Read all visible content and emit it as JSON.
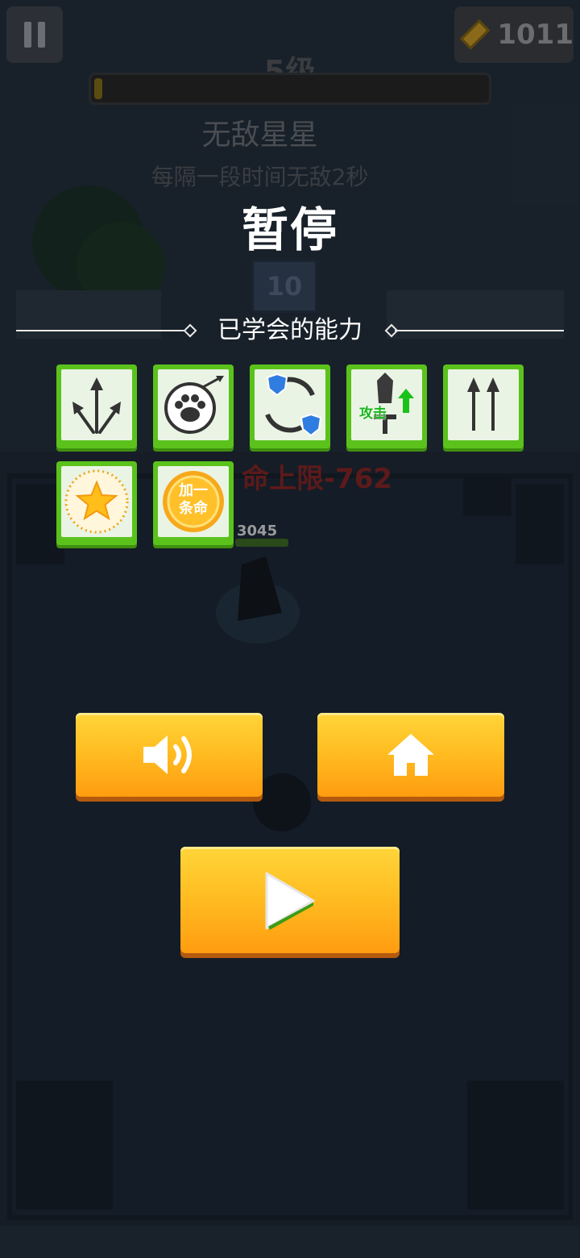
{
  "hud": {
    "coins": "1011",
    "level": "5级",
    "xp_progress": 0.02
  },
  "current_skill": {
    "name": "无敌星星",
    "description": "每隔一段时间无敌2秒"
  },
  "pause_menu": {
    "title": "暂停",
    "section_title": "已学会的能力",
    "abilities": [
      {
        "name": "diagonal-arrows",
        "label": ""
      },
      {
        "name": "pet-paw",
        "label": ""
      },
      {
        "name": "shield-rotate",
        "label": ""
      },
      {
        "name": "attack-up",
        "label": "攻击"
      },
      {
        "name": "double-arrows",
        "label": ""
      },
      {
        "name": "invincible-star",
        "label": ""
      },
      {
        "name": "extra-life",
        "label": "加一条命"
      }
    ],
    "buttons": {
      "sound": "speaker-icon",
      "home": "home-icon",
      "resume": "play-icon"
    }
  },
  "background": {
    "enemy_level": "10",
    "damage_text": "命上限-762",
    "player_hp": "3045"
  },
  "colors": {
    "tile_green": "#5bc21c",
    "button_orange": "#ffb01c",
    "title_white": "#ffffff"
  }
}
